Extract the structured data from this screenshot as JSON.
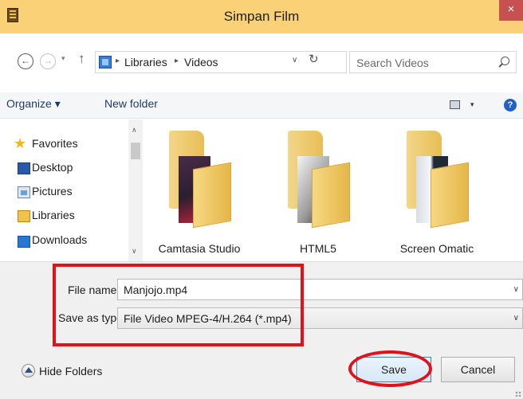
{
  "window": {
    "title": "Simpan Film",
    "close_label": "×"
  },
  "address": {
    "crumbs": [
      "Libraries",
      "Videos"
    ],
    "separators": [
      "▸",
      "▸"
    ],
    "search_placeholder": "Search Videos",
    "back_glyph": "←",
    "forward_glyph": "→",
    "recent_glyph": "▾",
    "up_glyph": "↑",
    "drop_glyph": "∨",
    "refresh_glyph": "↻"
  },
  "toolbar": {
    "organize": "Organize ▾",
    "new_folder": "New folder",
    "view_drop": "▾",
    "help": "?"
  },
  "nav": {
    "items": [
      {
        "label": "Favorites",
        "icon": "star-icon"
      },
      {
        "label": "Desktop",
        "icon": "desktop-icon"
      },
      {
        "label": "Pictures",
        "icon": "pictures-icon"
      },
      {
        "label": "Libraries",
        "icon": "libraries-icon"
      },
      {
        "label": "Downloads",
        "icon": "downloads-icon"
      }
    ],
    "scroll_up": "∧",
    "scroll_down": "∨",
    "favorites_star": "★"
  },
  "folders": [
    {
      "name": "Camtasia Studio",
      "doc_color": "#2a1f2e"
    },
    {
      "name": "HTML5",
      "doc_color": "#8a8a8a"
    },
    {
      "name": "Screen Omatic",
      "doc_color": "#1e2b33"
    }
  ],
  "form": {
    "file_name_label": "File name:",
    "file_name_value": "Manjojo.mp4",
    "save_type_label": "Save as type:",
    "save_type_value": "File Video MPEG-4/H.264 (*.mp4)",
    "drop": "∨"
  },
  "footer": {
    "hide_folders": "Hide Folders",
    "save": "Save",
    "cancel": "Cancel"
  },
  "colors": {
    "title_bar": "#fbd178",
    "close": "#c75050",
    "highlight": "#e0121b",
    "save_border": "#3c7fb1"
  }
}
